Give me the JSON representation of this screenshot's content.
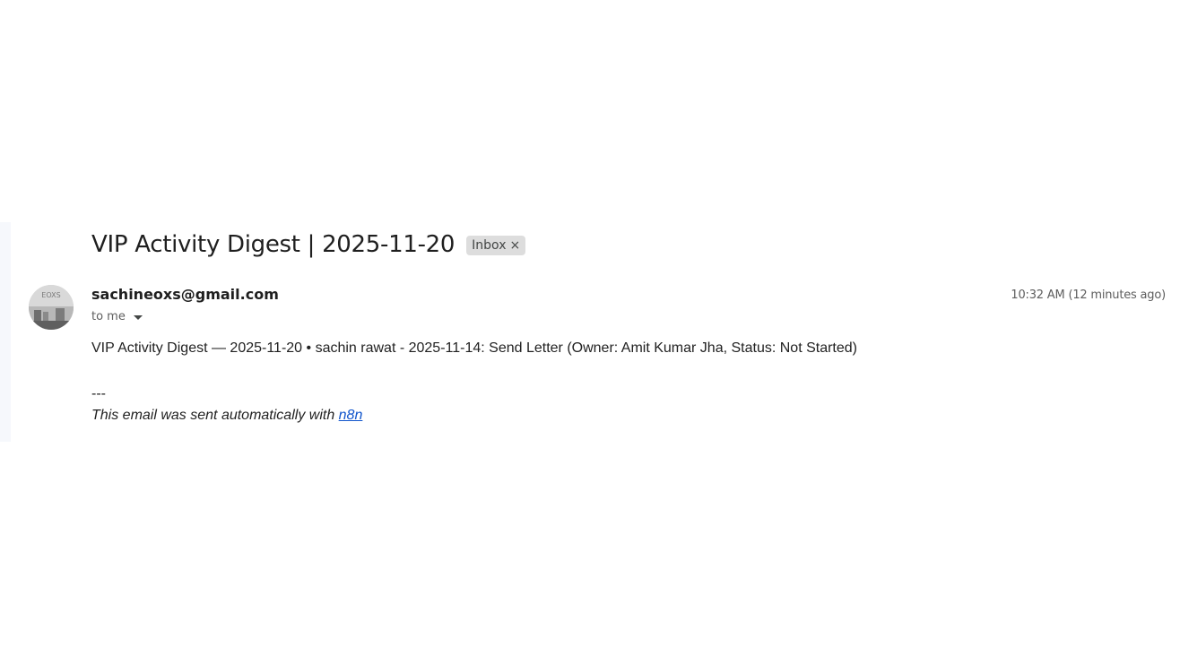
{
  "email": {
    "subject": "VIP Activity Digest | 2025-11-20",
    "label": {
      "name": "Inbox",
      "remove_glyph": "×"
    },
    "sender": {
      "address": "sachineoxs@gmail.com",
      "avatar_text": "EOXS"
    },
    "recipient": {
      "text": "to me"
    },
    "timestamp": "10:32 AM (12 minutes ago)",
    "body": {
      "line": "VIP Activity Digest — 2025-11-20 • sachin rawat - 2025-11-14: Send Letter (Owner: Amit Kumar Jha, Status: Not Started)",
      "separator": "---",
      "footer_prefix": "This email was sent automatically with ",
      "footer_link": "n8n"
    }
  },
  "colors": {
    "link": "#1155cc",
    "chip_bg": "#dddddd",
    "muted_text": "#5e5e5e"
  }
}
